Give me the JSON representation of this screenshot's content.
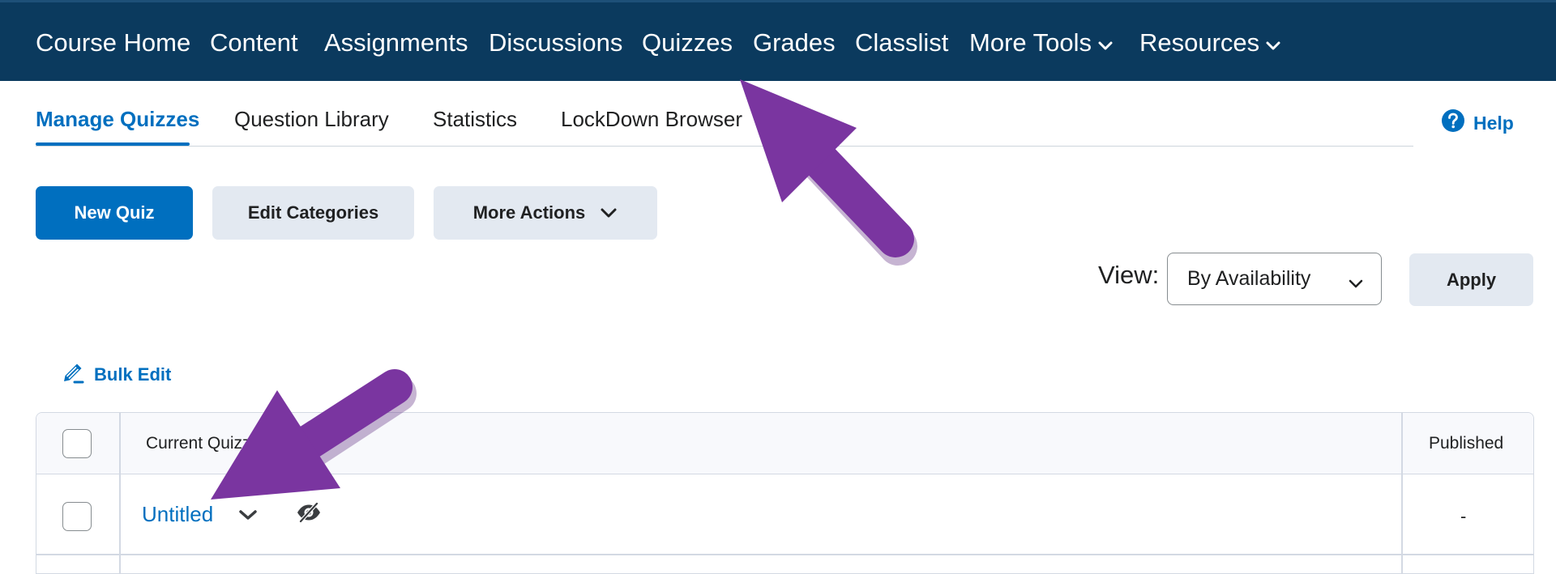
{
  "nav": {
    "items": [
      "Course Home",
      "Content",
      "Assignments",
      "Discussions",
      "Quizzes",
      "Grades",
      "Classlist",
      "More Tools",
      "Resources"
    ]
  },
  "tabs": {
    "items": [
      "Manage Quizzes",
      "Question Library",
      "Statistics",
      "LockDown Browser"
    ],
    "active": "Manage Quizzes"
  },
  "help": {
    "label": "Help",
    "icon": "help-circle-icon"
  },
  "toolbar": {
    "new_quiz": "New Quiz",
    "edit_categories": "Edit Categories",
    "more_actions": "More Actions"
  },
  "view": {
    "label": "View:",
    "selected": "By Availability",
    "apply": "Apply"
  },
  "bulk_edit": {
    "label": "Bulk Edit",
    "icon": "pencil-icon"
  },
  "table": {
    "columns": [
      "Current Quizzes",
      "Published"
    ],
    "rows": [
      {
        "name": "Untitled",
        "published": "-"
      }
    ]
  },
  "colors": {
    "nav_background": "#0b3a5e",
    "accent": "#006fbf",
    "annotation_arrow": "#7a35a0"
  }
}
